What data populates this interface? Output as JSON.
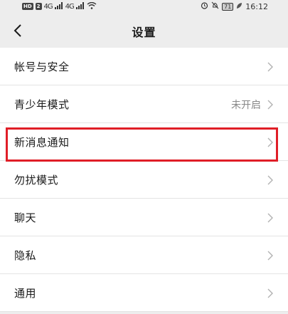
{
  "status_bar": {
    "hd_badge": "HD",
    "sim_badge": "2",
    "net1": "4G",
    "net2": "4G",
    "battery": "71",
    "time": "16:12"
  },
  "header": {
    "title": "设置",
    "back_icon": "chevron-left-icon"
  },
  "settings": {
    "items": [
      {
        "label": "帐号与安全",
        "value": ""
      },
      {
        "label": "青少年模式",
        "value": "未开启"
      },
      {
        "label": "新消息通知",
        "value": ""
      },
      {
        "label": "勿扰模式",
        "value": ""
      },
      {
        "label": "聊天",
        "value": ""
      },
      {
        "label": "隐私",
        "value": ""
      },
      {
        "label": "通用",
        "value": ""
      }
    ],
    "highlighted_item": "新消息通知",
    "highlight_color": "#e01e27"
  }
}
